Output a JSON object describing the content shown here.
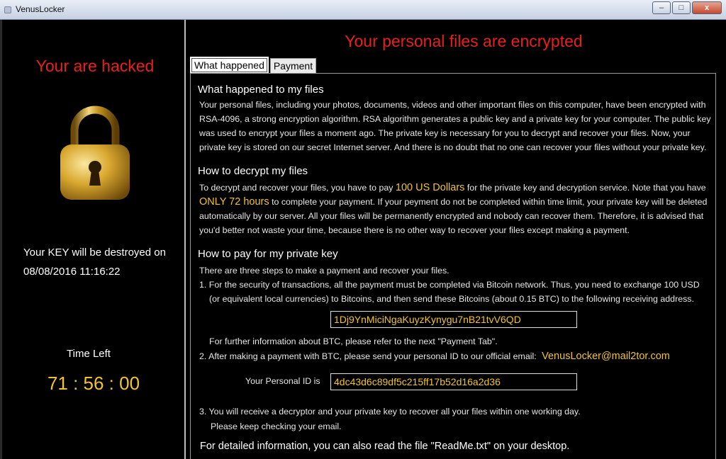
{
  "window": {
    "title": "VenusLocker",
    "controls": {
      "minimize": "–",
      "maximize": "□",
      "close": "x"
    }
  },
  "left": {
    "hacked_text": "Your are hacked",
    "lock_icon": "padlock-icon",
    "key_line1": "Your KEY will be destroyed on",
    "key_line2": "08/08/2016 11:16:22",
    "time_left_label": "Time Left",
    "timer": "71 : 56 : 00"
  },
  "main": {
    "title": "Your personal files are encrypted",
    "tabs": [
      {
        "label": "What happened",
        "active": true
      },
      {
        "label": "Payment",
        "active": false
      }
    ],
    "sections": {
      "what_heading": "What happened to my files",
      "what_body": "Your personal files, including your photos, documents, videos and other important files on this computer, have been encrypted with RSA-4096, a strong encryption algorithm. RSA algorithm generates a public key and a private key for your computer. The public key was used to encrypt your files a moment ago. The private key is necessary for you to decrypt and recover your files. Now, your private key is stored on our secret Internet server. And there is no doubt that no one can recover your files without your private key.",
      "decrypt_heading": "How to decrypt my files",
      "decrypt_p1": "To decrypt and recover your files, you have to pay",
      "decrypt_amount": "100 US Dollars",
      "decrypt_p2": "for the private key and decryption service. Note that you have",
      "decrypt_deadline": "ONLY 72 hours",
      "decrypt_p3": "to complete your payment. If your peyment do not be completed within time limit, your private key will be deleted automatically by our server. All your files will be permanently encrypted and nobody can recover them. Therefore, it is advised that you'd better not waste your time, because there is no other way to recover your files except making a payment.",
      "pay_heading": "How to pay for my private key",
      "pay_intro": "There are three steps to make a payment and recover your files.",
      "step1": "1. For the security of transactions, all the payment must be completed via Bitcoin network. Thus, you need to exchange 100 USD",
      "step1b": "(or equivalent local currencies) to Bitcoins, and then send these Bitcoins (about 0.15 BTC) to the following receiving address.",
      "btc_address": "1Dj9YnMiciNgaKuyzKynygu7nB21tvV6QD",
      "btc_note": "For further information about BTC, please refer to the next \"Payment Tab\".",
      "step2": "2. After making a payment with BTC, please send your personal ID to our official email:",
      "email": "VenusLocker@mail2tor.com",
      "personal_id_label": "Your Personal ID is",
      "personal_id": "4dc43d6c89df5c215ff17b52d16a2d36",
      "step3": "3. You will receive a decryptor and your private key to recover all your files within one working day.",
      "step3b": "Please keep checking your email.",
      "footer": "For detailed information, you can also read the file \"ReadMe.txt\" on your desktop."
    }
  },
  "colors": {
    "accent_red": "#e8201d",
    "accent_yellow": "#f0c42a",
    "background": "#000000"
  }
}
